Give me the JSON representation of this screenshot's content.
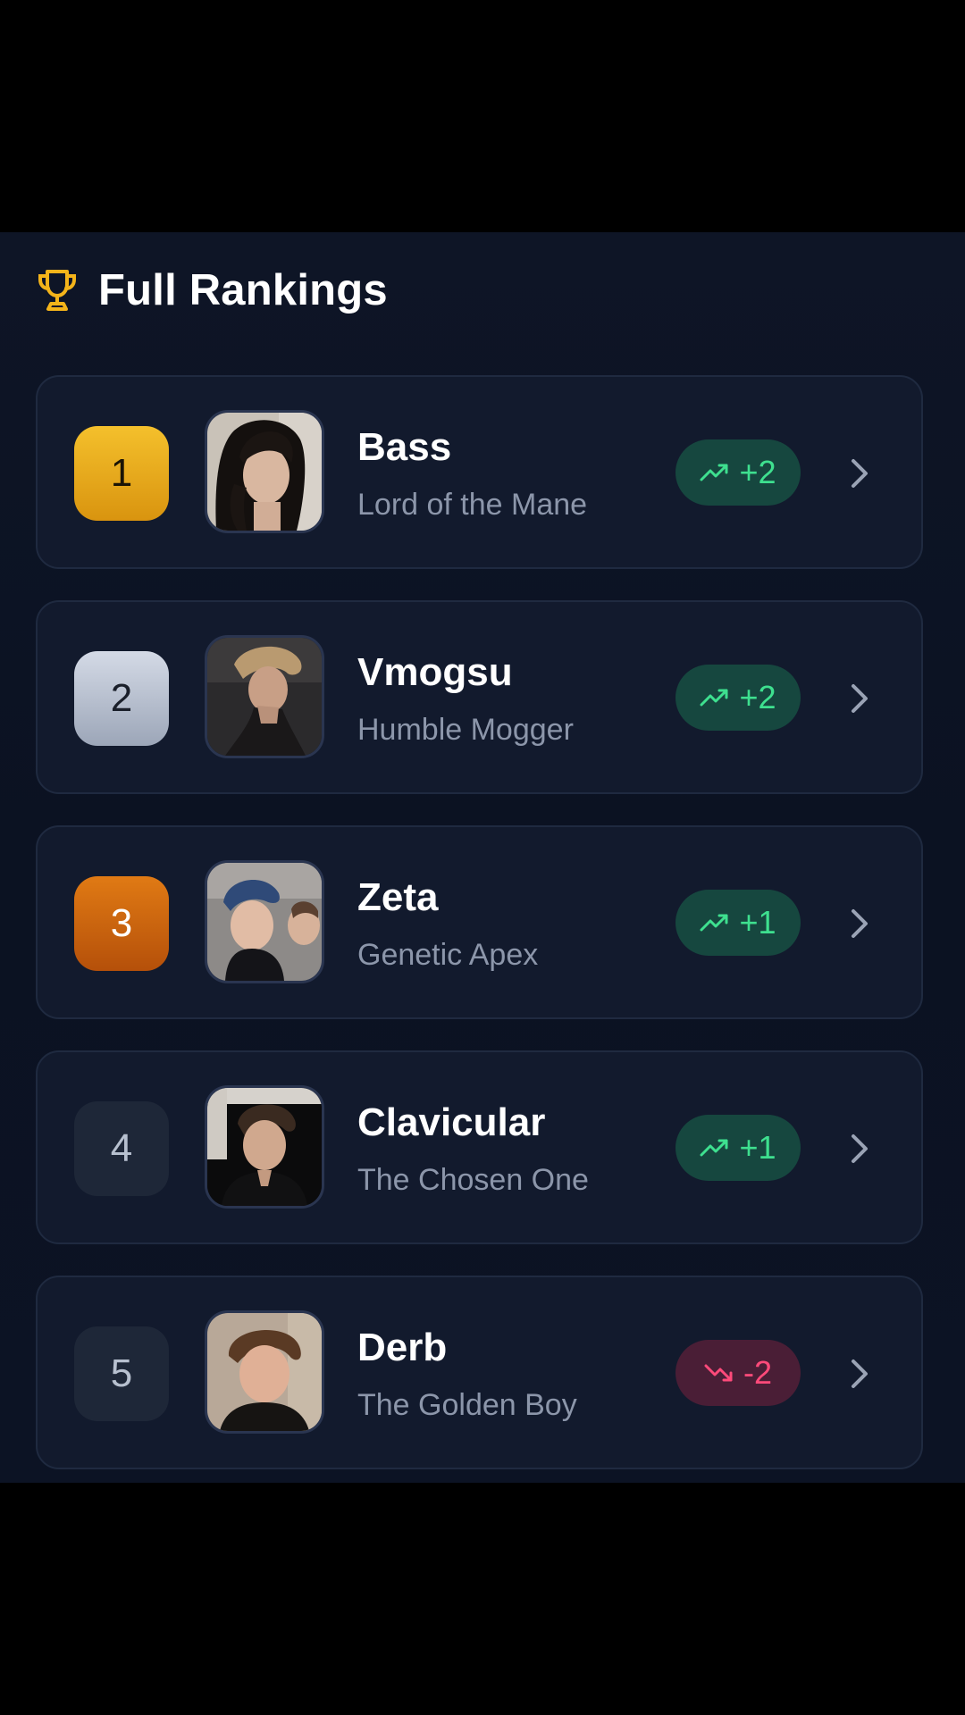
{
  "header": {
    "title": "Full Rankings",
    "icon": "trophy-icon",
    "accent_color": "#f4b41a"
  },
  "rankings": [
    {
      "rank": "1",
      "name": "Bass",
      "title": "Lord of the Mane",
      "change": "+2",
      "trend": "up",
      "medal": "gold"
    },
    {
      "rank": "2",
      "name": "Vmogsu",
      "title": "Humble Mogger",
      "change": "+2",
      "trend": "up",
      "medal": "silver"
    },
    {
      "rank": "3",
      "name": "Zeta",
      "title": "Genetic Apex",
      "change": "+1",
      "trend": "up",
      "medal": "bronze"
    },
    {
      "rank": "4",
      "name": "Clavicular",
      "title": "The Chosen One",
      "change": "+1",
      "trend": "up",
      "medal": "none"
    },
    {
      "rank": "5",
      "name": "Derb",
      "title": "The Golden Boy",
      "change": "-2",
      "trend": "down",
      "medal": "none"
    }
  ],
  "colors": {
    "trend_up": "#3ee08f",
    "trend_down": "#ff4a7a",
    "gold": "#f4c02c",
    "silver": "#c4cbd8",
    "bronze": "#d86a10"
  }
}
